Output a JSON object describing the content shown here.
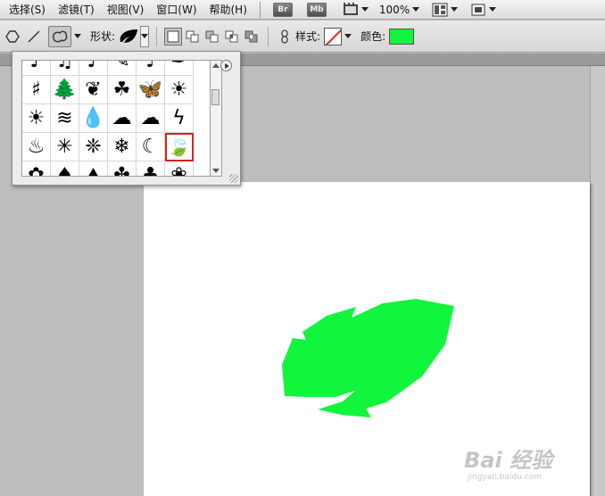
{
  "menubar": {
    "items": [
      "选择(S)",
      "滤镜(T)",
      "视图(V)",
      "窗口(W)",
      "帮助(H)"
    ],
    "bridge_label": "Br",
    "minibridge_label": "Mb",
    "zoom": "100%"
  },
  "options": {
    "shape_label": "形状:",
    "style_label": "样式:",
    "color_label": "颜色:",
    "color": "#11f53c"
  },
  "shape_picker": {
    "glyphs": [
      "♪",
      "♫",
      "♪",
      "✎",
      "♩",
      "✒",
      "♯",
      "🌲",
      "❦",
      "☘",
      "🦋",
      "☀",
      "☀",
      "≋",
      "💧",
      "☁",
      "☁",
      "ϟ",
      "♨",
      "✳",
      "❈",
      "❄",
      "☾",
      "🍃",
      "✿",
      "♠",
      "⛰",
      "✤",
      "♣",
      "❀"
    ],
    "selected_index": 23
  },
  "canvas": {
    "shape": "leaf",
    "fill": "#11f53c"
  },
  "watermark": {
    "main": "Bai 经验",
    "sub": "jingyan.baidu.com"
  }
}
